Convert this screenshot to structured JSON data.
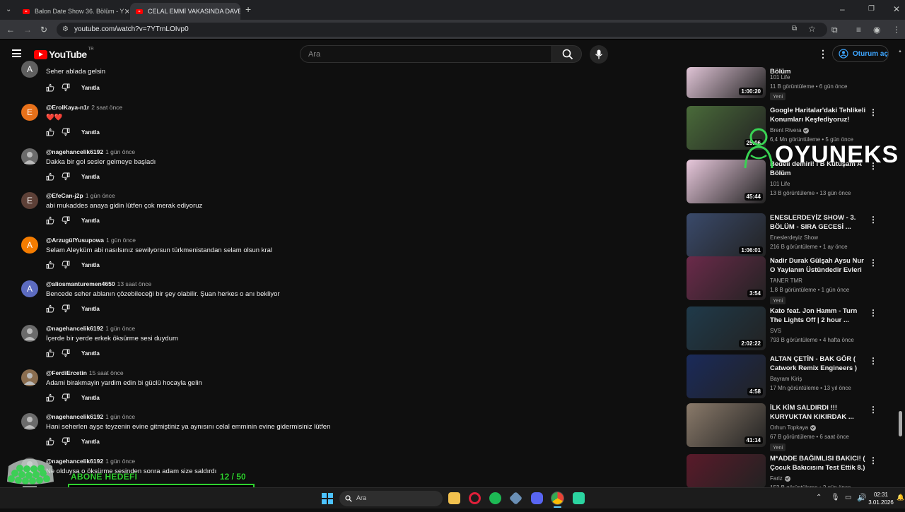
{
  "browser": {
    "tabs": [
      {
        "title": "Balon Date Show 36. Bölüm - Y"
      },
      {
        "title": "CELAL EMMİ VAKASINDA DAVE"
      }
    ],
    "url": "youtube.com/watch?v=7YTrnLOIvp0"
  },
  "youtube": {
    "logo": "YouTube",
    "region": "TR",
    "search_placeholder": "Ara",
    "signin_label": "Oturum aç"
  },
  "comments": [
    {
      "avatar_letter": "A",
      "avatar_color": "#5f5f5f",
      "user": "",
      "time": "",
      "text": "Seher ablada gelsin",
      "reply": "Yanıtla"
    },
    {
      "avatar_letter": "E",
      "avatar_color": "#e8711a",
      "user": "@ErolKaya-n1r",
      "time": "2 saat önce",
      "text": "❤️❤️",
      "reply": "Yanıtla"
    },
    {
      "avatar_letter": "",
      "avatar_color": "#6b6b6b",
      "user": "@nagehancelik6192",
      "time": "1 gün önce",
      "text": "Dakka bir gol sesler gelmeye başladı",
      "reply": "Yanıtla"
    },
    {
      "avatar_letter": "E",
      "avatar_color": "#5d4037",
      "user": "@EfeCan-j2p",
      "time": "1 gün önce",
      "text": "abi mukaddes anaya gidin lütfen çok merak ediyoruz",
      "reply": "Yanıtla"
    },
    {
      "avatar_letter": "A",
      "avatar_color": "#f57c00",
      "user": "@ArzugülYusupowa",
      "time": "1 gün önce",
      "text": "Selam Aleyküm abi nasılsınız sewilyorsun türkmenistandan selam olsun kral",
      "reply": "Yanıtla"
    },
    {
      "avatar_letter": "A",
      "avatar_color": "#5c6bc0",
      "user": "@aliosmanturemen4650",
      "time": "13 saat önce",
      "text": "Bencede seher ablanın çözebileceği bir şey olabilir. Şuan herkes o anı bekliyor",
      "reply": "Yanıtla"
    },
    {
      "avatar_letter": "",
      "avatar_color": "#6b6b6b",
      "user": "@nagehancelik6192",
      "time": "1 gün önce",
      "text": "İçerde bir yerde erkek öksürme sesi duydum",
      "reply": "Yanıtla"
    },
    {
      "avatar_letter": "",
      "avatar_color": "#8a6d4f",
      "user": "@FerdiErcetin",
      "time": "15 saat önce",
      "text": "Adami birakmayin yardim edin bi güclü hocayla gelin",
      "reply": "Yanıtla"
    },
    {
      "avatar_letter": "",
      "avatar_color": "#6b6b6b",
      "user": "@nagehancelik6192",
      "time": "1 gün önce",
      "text": "Hani seherlen ayşe teyzenin evine gitmiştiniz ya aynısını celal emminin evine gidermisiniz lütfen",
      "reply": "Yanıtla"
    },
    {
      "avatar_letter": "",
      "avatar_color": "#6b6b6b",
      "user": "@nagehancelik6192",
      "time": "1 gün önce",
      "text": "Ne olduysa o öksürme sesinden sonra adam size saldırdı",
      "reply": ""
    }
  ],
  "related": [
    {
      "title": "Bölüm",
      "channel": "101 Life",
      "verified": false,
      "meta": "11 B görüntüleme • 6 gün önce",
      "duration": "1:00:20",
      "new": "Yeni",
      "thumb_color": "#e0c4d6"
    },
    {
      "title": "Google Haritalar'daki Tehlikeli Konumları Keşfediyoruz!",
      "channel": "Brent Rivera",
      "verified": true,
      "meta": "6,4 Mn görüntüleme • 5 gün önce",
      "duration": "25:06",
      "new": "",
      "thumb_color": "#4a6b3a"
    },
    {
      "title": "Bedeli demiri! I B Kütüşam A Bölüm",
      "channel": "101 Life",
      "verified": false,
      "meta": "13 B görüntüleme • 13 gün önce",
      "duration": "45:44",
      "new": "",
      "thumb_color": "#e8c8dc"
    },
    {
      "title": "ENESLERDEYİZ SHOW - 3. BÖLÜM - SIRA GECESİ ...",
      "channel": "Eneslerdeyiz Show",
      "verified": false,
      "meta": "216 B görüntüleme • 1 ay önce",
      "duration": "1:06:01",
      "new": "",
      "thumb_color": "#3a4a6b"
    },
    {
      "title": "Nadir Durak Gülşah Aysu Nur O Yaylanın Üstündedir Evleri Su ...",
      "channel": "TANER TMR",
      "verified": false,
      "meta": "1,8 B görüntüleme • 1 gün önce",
      "duration": "3:54",
      "new": "Yeni",
      "thumb_color": "#6b2a4a"
    },
    {
      "title": "Kato feat. Jon Hamm - Turn The Lights Off | 2 hour ...",
      "channel": "SVS",
      "verified": false,
      "meta": "793 B görüntüleme • 4 hafta önce",
      "duration": "2:02:22",
      "new": "",
      "thumb_color": "#1f3a4a"
    },
    {
      "title": "ALTAN ÇETİN - BAK GÖR ( Catwork Remix Engineers )",
      "channel": "Bayram Kiriş",
      "verified": false,
      "meta": "17 Mn görüntüleme • 13 yıl önce",
      "duration": "4:58",
      "new": "",
      "thumb_color": "#1a2a5a"
    },
    {
      "title": "İLK KİM SALDIRDI !!! KURYUKTAN KIKIRDAK ...",
      "channel": "Orhun Topkaya",
      "verified": true,
      "meta": "67 B görüntüleme • 6 saat önce",
      "duration": "41:14",
      "new": "Yeni",
      "thumb_color": "#8a7a6a"
    },
    {
      "title": "M*ADDE BAĞIMLISI BAKICI! ( Çocuk Bakıcısını Test Ettik 8.)",
      "channel": "Fariz",
      "verified": true,
      "meta": "153 B görüntüleme • 2 gün önce",
      "duration": "",
      "new": "",
      "thumb_color": "#5a1a2a"
    }
  ],
  "overlay": {
    "brand": "OYUNEKS",
    "goal_label": "ABONE HEDEFİ",
    "goal_count": "12 / 50",
    "goal_progress": 0.24
  },
  "taskbar": {
    "search_placeholder": "Ara",
    "time": "02:31",
    "date": "3.01.2026"
  },
  "colors": {
    "accent": "#3ea6ff",
    "brand_red": "#ff0000",
    "goal_green": "#2fd12f"
  }
}
